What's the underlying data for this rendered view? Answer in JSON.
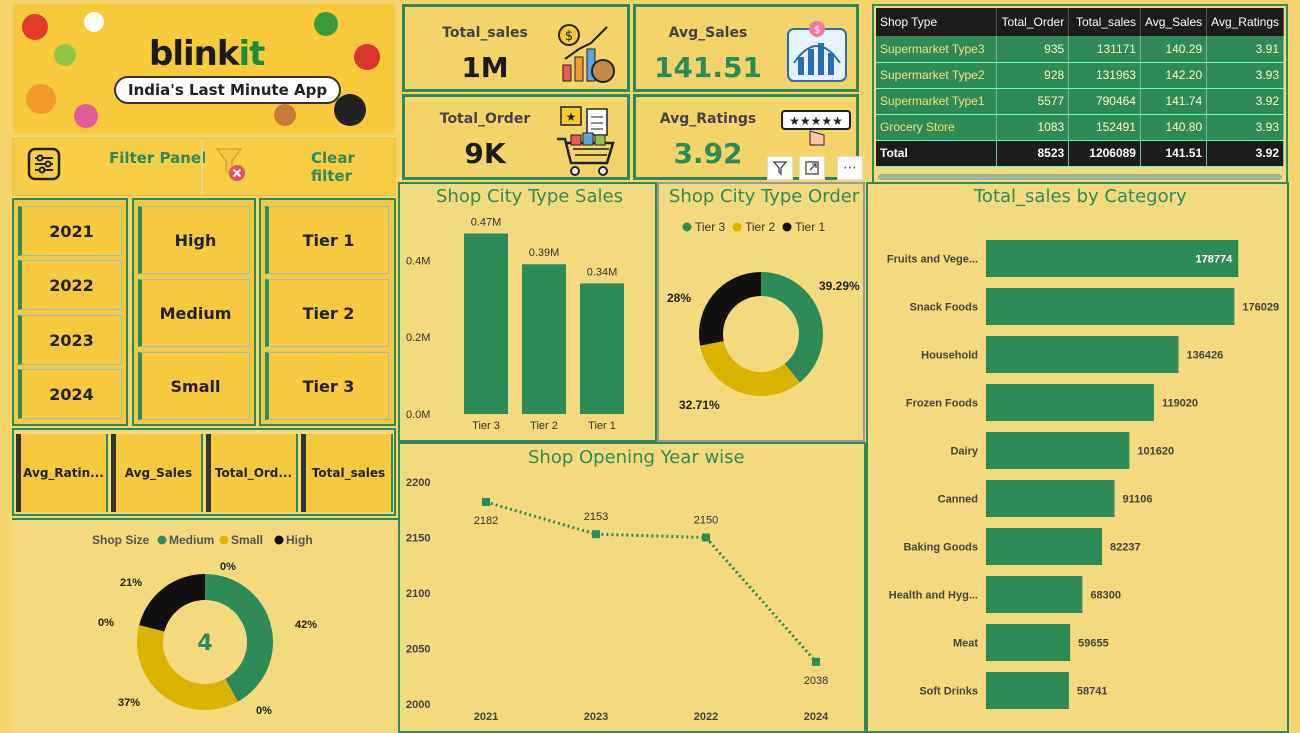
{
  "banner": {
    "logo_main": "blink",
    "logo_accent": "it",
    "tagline": "India's Last Minute App"
  },
  "filter_panel": {
    "label": "Filter Panel",
    "clear_label": "Clear filter"
  },
  "slicers": {
    "years": [
      "2021",
      "2022",
      "2023",
      "2024"
    ],
    "sizes": [
      "High",
      "Medium",
      "Small"
    ],
    "tiers": [
      "Tier 1",
      "Tier 2",
      "Tier 3"
    ],
    "measures": [
      "Avg_Ratin...",
      "Avg_Sales",
      "Total_Ord...",
      "Total_sales"
    ]
  },
  "kpis": {
    "total_sales": {
      "title": "Total_sales",
      "value": "1M"
    },
    "avg_sales": {
      "title": "Avg_Sales",
      "value": "141.51"
    },
    "total_order": {
      "title": "Total_Order",
      "value": "9K"
    },
    "avg_ratings": {
      "title": "Avg_Ratings",
      "value": "3.92"
    }
  },
  "shop_table": {
    "headers": [
      "Shop Type",
      "Total_Order",
      "Total_sales",
      "Avg_Sales",
      "Avg_Ratings"
    ],
    "rows": [
      [
        "Supermarket Type3",
        "935",
        "131171",
        "140.29",
        "3.91"
      ],
      [
        "Supermarket Type2",
        "928",
        "131963",
        "142.20",
        "3.93"
      ],
      [
        "Supermarket Type1",
        "5577",
        "790464",
        "141.74",
        "3.92"
      ],
      [
        "Grocery Store",
        "1083",
        "152491",
        "140.80",
        "3.93"
      ]
    ],
    "total": [
      "Total",
      "8523",
      "1206089",
      "141.51",
      "3.92"
    ]
  },
  "colors": {
    "green": "#2e8b57",
    "gold": "#d9b300",
    "black": "#111111",
    "bg": "#f3da7e"
  },
  "chart_data": [
    {
      "type": "bar",
      "title": "Shop City Type Sales",
      "categories": [
        "Tier 3",
        "Tier 2",
        "Tier 1"
      ],
      "values": [
        0.47,
        0.39,
        0.34
      ],
      "data_labels": [
        "0.47M",
        "0.39M",
        "0.34M"
      ],
      "yticks": [
        "0.0M",
        "0.2M",
        "0.4M"
      ],
      "ylim": [
        0,
        0.5
      ]
    },
    {
      "type": "pie",
      "title": "Shop City Type Order",
      "legend": [
        "Tier 3",
        "Tier 2",
        "Tier 1"
      ],
      "values": [
        39.29,
        32.71,
        28
      ],
      "data_labels": [
        "39.29%",
        "32.71%",
        "28%"
      ]
    },
    {
      "type": "bar",
      "title": "Total_sales by Category",
      "categories": [
        "Fruits and Vege...",
        "Snack Foods",
        "Household",
        "Frozen Foods",
        "Dairy",
        "Canned",
        "Baking Goods",
        "Health and Hyg...",
        "Meat",
        "Soft Drinks"
      ],
      "values": [
        178774,
        176029,
        136426,
        119020,
        101620,
        91106,
        82237,
        68300,
        59655,
        58741
      ]
    },
    {
      "type": "line",
      "title": "Shop Opening Year wise",
      "x": [
        "2021",
        "2023",
        "2022",
        "2024"
      ],
      "values": [
        2182,
        2153,
        2150,
        2038
      ],
      "yticks": [
        "2000",
        "2050",
        "2100",
        "2150",
        "2200"
      ],
      "ylim": [
        2000,
        2200
      ]
    },
    {
      "type": "pie",
      "title": "",
      "legend_title": "Shop Size",
      "legend": [
        "Medium",
        "Small",
        "High"
      ],
      "values": [
        42,
        37,
        21
      ],
      "data_labels": [
        "42%",
        "37%",
        "21%"
      ],
      "zero_labels": [
        "0%",
        "0%",
        "0%"
      ],
      "center_value": "4"
    }
  ]
}
